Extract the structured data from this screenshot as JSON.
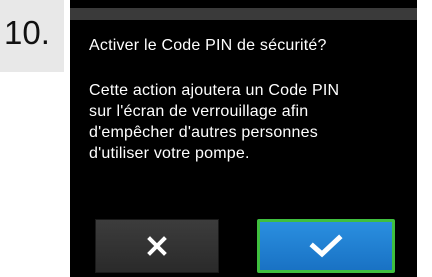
{
  "step": {
    "number": "10."
  },
  "dialog": {
    "title": "Activer le Code PIN de sécurité?",
    "body_lines": [
      "Cette action ajoutera un Code PIN",
      "sur l'écran de verrouillage afin",
      "d'empêcher d'autres personnes",
      "d'utiliser votre pompe."
    ]
  },
  "buttons": {
    "cancel_icon": "close-x-icon",
    "confirm_icon": "checkmark-icon"
  },
  "colors": {
    "screen_background": "#000000",
    "confirm_button": "#2180d4",
    "confirm_highlight": "#3fbf3f",
    "cancel_button": "#333333"
  }
}
